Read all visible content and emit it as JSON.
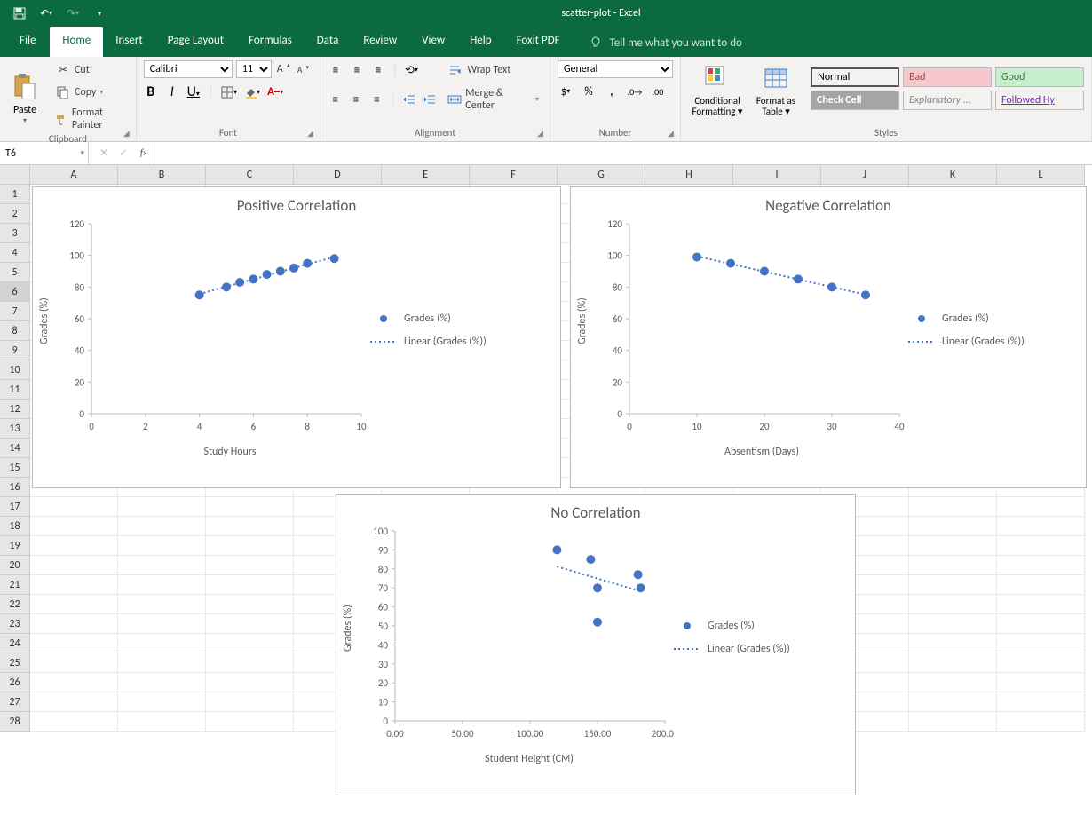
{
  "app": {
    "title": "scatter-plot  -  Excel"
  },
  "qa": {
    "save": "💾",
    "undo": "↶",
    "redo": "↷",
    "custom": "▾"
  },
  "tabs": {
    "file": "File",
    "home": "Home",
    "insert": "Insert",
    "layout": "Page Layout",
    "formulas": "Formulas",
    "data": "Data",
    "review": "Review",
    "view": "View",
    "help": "Help",
    "foxit": "Foxit PDF",
    "tell": "Tell me what you want to do"
  },
  "ribbon": {
    "clipboard": {
      "label": "Clipboard",
      "paste": "Paste",
      "cut": "Cut",
      "copy": "Copy",
      "painter": "Format Painter"
    },
    "font": {
      "label": "Font",
      "name": "Calibri",
      "size": "11",
      "bold": "B",
      "italic": "I",
      "underline": "U"
    },
    "alignment": {
      "label": "Alignment",
      "wrap": "Wrap Text",
      "merge": "Merge & Center"
    },
    "number": {
      "label": "Number",
      "format": "General"
    },
    "styles": {
      "label": "Styles",
      "cond": "Conditional Formatting",
      "table": "Format as Table",
      "normal": "Normal",
      "bad": "Bad",
      "good": "Good",
      "check": "Check Cell",
      "explan": "Explanatory ...",
      "followed": "Followed Hy"
    }
  },
  "namebox": "T6",
  "columns": [
    "A",
    "B",
    "C",
    "D",
    "E",
    "F",
    "G",
    "H",
    "I",
    "J",
    "K",
    "L"
  ],
  "rowcount": 28,
  "selectedRow": 6,
  "legend": {
    "series": "Grades (%)",
    "trend": "Linear (Grades (%))"
  },
  "chart_data": [
    {
      "type": "scatter",
      "title": "Positive Correlation",
      "xlabel": "Study Hours",
      "ylabel": "Grades (%)",
      "xlim": [
        0,
        10
      ],
      "ylim": [
        0,
        120
      ],
      "xticks": [
        0,
        2,
        4,
        6,
        8,
        10
      ],
      "yticks": [
        0,
        20,
        40,
        60,
        80,
        100,
        120
      ],
      "x": [
        4,
        5,
        5.5,
        6,
        6.5,
        7,
        7.5,
        8,
        9
      ],
      "y": [
        75,
        80,
        83,
        85,
        88,
        90,
        92,
        95,
        98
      ]
    },
    {
      "type": "scatter",
      "title": "Negative Correlation",
      "xlabel": "Absentism (Days)",
      "ylabel": "Grades (%)",
      "xlim": [
        0,
        40
      ],
      "ylim": [
        0,
        120
      ],
      "xticks": [
        0,
        10,
        20,
        30,
        40
      ],
      "yticks": [
        0,
        20,
        40,
        60,
        80,
        100,
        120
      ],
      "x": [
        10,
        15,
        20,
        25,
        30,
        35
      ],
      "y": [
        99,
        95,
        90,
        85,
        80,
        75
      ]
    },
    {
      "type": "scatter",
      "title": "No Correlation",
      "xlabel": "Student Height (CM)",
      "ylabel": "Grades (%)",
      "xlim": [
        0,
        200
      ],
      "ylim": [
        0,
        100
      ],
      "xticks": [
        0,
        50,
        100,
        150,
        200
      ],
      "xticklabels": [
        "0.00",
        "50.00",
        "100.00",
        "150.00",
        "200.00"
      ],
      "yticks": [
        0,
        10,
        20,
        30,
        40,
        50,
        60,
        70,
        80,
        90,
        100
      ],
      "x": [
        120,
        145,
        150,
        150,
        180,
        182
      ],
      "y": [
        90,
        85,
        70,
        52,
        77,
        70
      ]
    }
  ]
}
